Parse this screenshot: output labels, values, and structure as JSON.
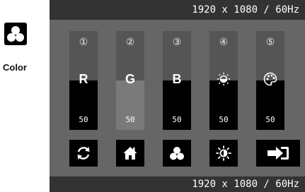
{
  "category": {
    "label": "Color",
    "icon": "color-circles-icon"
  },
  "status": {
    "top_text": "1920 x 1080 / 60Hz",
    "bottom_text": "1920 x 1080 / 60Hz"
  },
  "sliders": [
    {
      "index": "①",
      "label": "R",
      "icon": null,
      "value": "50",
      "level": 0.5
    },
    {
      "index": "②",
      "label": "G",
      "icon": null,
      "value": "50",
      "level": 0.5
    },
    {
      "index": "③",
      "label": "B",
      "icon": null,
      "value": "50",
      "level": 0.5
    },
    {
      "index": "④",
      "label": "",
      "icon": "dim-brightness-icon",
      "value": "50",
      "level": 0.5
    },
    {
      "index": "⑤",
      "label": "",
      "icon": "palette-icon",
      "value": "50",
      "level": 0.5
    }
  ],
  "buttons": [
    {
      "icon": "refresh-icon"
    },
    {
      "icon": "home-icon"
    },
    {
      "icon": "color-circles-icon"
    },
    {
      "icon": "brightness-icon"
    },
    {
      "icon": "exit-icon"
    }
  ]
}
